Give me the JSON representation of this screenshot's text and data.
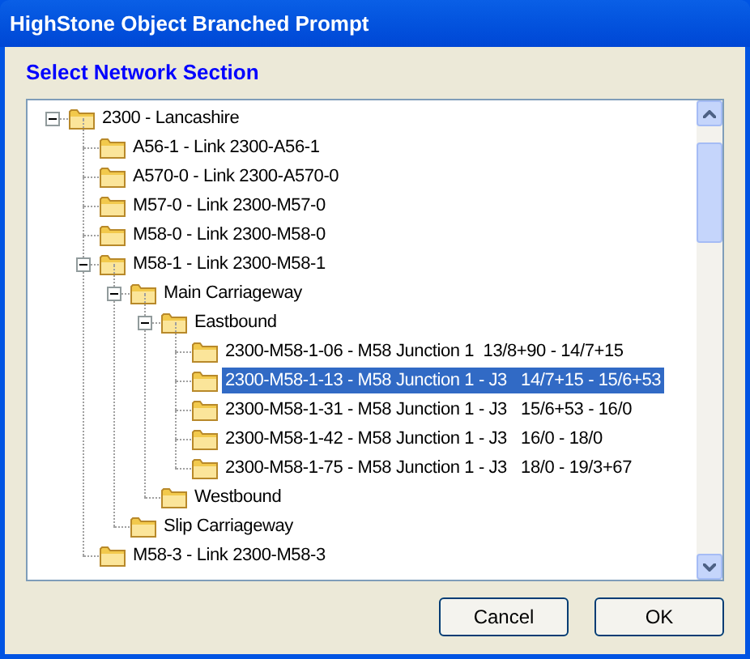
{
  "window": {
    "title": "HighStone Object Branched Prompt"
  },
  "heading": "Select Network Section",
  "tree": [
    {
      "label": "2300 - Lancashire",
      "expanded": true,
      "selected": false,
      "children": [
        {
          "label": "A56-1 - Link 2300-A56-1",
          "selected": false
        },
        {
          "label": "A570-0 - Link 2300-A570-0",
          "selected": false
        },
        {
          "label": "M57-0 - Link 2300-M57-0",
          "selected": false
        },
        {
          "label": "M58-0 - Link 2300-M58-0",
          "selected": false
        },
        {
          "label": "M58-1 - Link 2300-M58-1",
          "expanded": true,
          "selected": false,
          "children": [
            {
              "label": "Main Carriageway",
              "expanded": true,
              "selected": false,
              "children": [
                {
                  "label": "Eastbound",
                  "expanded": true,
                  "selected": false,
                  "children": [
                    {
                      "label": "2300-M58-1-06 - M58 Junction 1  13/8+90 - 14/7+15",
                      "selected": false
                    },
                    {
                      "label": "2300-M58-1-13 - M58 Junction 1 - J3   14/7+15 - 15/6+53",
                      "selected": true
                    },
                    {
                      "label": "2300-M58-1-31 - M58 Junction 1 - J3   15/6+53 - 16/0",
                      "selected": false
                    },
                    {
                      "label": "2300-M58-1-42 - M58 Junction 1 - J3   16/0 - 18/0",
                      "selected": false
                    },
                    {
                      "label": "2300-M58-1-75 - M58 Junction 1 - J3   18/0 - 19/3+67",
                      "selected": false
                    }
                  ]
                },
                {
                  "label": "Westbound",
                  "selected": false
                }
              ]
            },
            {
              "label": "Slip Carriageway",
              "selected": false
            }
          ]
        },
        {
          "label": "M58-3 - Link 2300-M58-3",
          "selected": false
        }
      ]
    }
  ],
  "buttons": [
    "Cancel",
    "OK"
  ]
}
